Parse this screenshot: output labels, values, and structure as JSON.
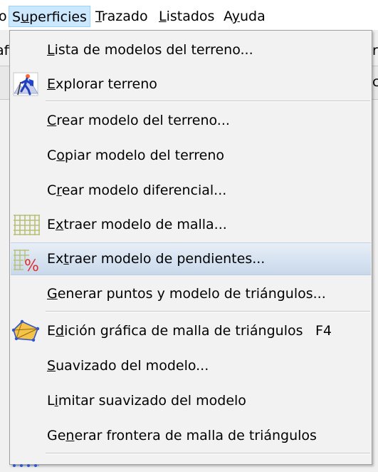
{
  "menubar": {
    "items": [
      {
        "label": "o",
        "mnemonic_pre": "o",
        "mnemonic": "",
        "mnemonic_post": ""
      },
      {
        "label": "Superficies",
        "pre": "S",
        "mn": "u",
        "post": "perficies"
      },
      {
        "label": "Trazado",
        "pre": "",
        "mn": "T",
        "post": "razado"
      },
      {
        "label": "Listados",
        "pre": "",
        "mn": "L",
        "post": "istados"
      },
      {
        "label": "Ayuda",
        "pre": "A",
        "mn": "y",
        "post": "uda"
      }
    ]
  },
  "behind": {
    "left_fragment": "afi",
    "right_fragment_top": "r",
    "right_fragment_bottom": "c"
  },
  "menu": {
    "items": [
      {
        "pre": "",
        "mn": "L",
        "post": "ista de modelos del terreno...",
        "icon": "none"
      },
      {
        "pre": "",
        "mn": "E",
        "post": "xplorar terreno",
        "icon": "hiker-icon"
      },
      {
        "pre": "",
        "mn": "C",
        "post": "rear modelo del terreno...",
        "icon": "none"
      },
      {
        "pre": "C",
        "mn": "o",
        "post": "piar modelo del terreno",
        "icon": "none"
      },
      {
        "pre": "C",
        "mn": "r",
        "post": "ear modelo diferencial...",
        "icon": "none"
      },
      {
        "pre": "E",
        "mn": "x",
        "post": "traer modelo de malla...",
        "icon": "grid-icon"
      },
      {
        "pre": "Ex",
        "mn": "t",
        "post": "raer modelo de pendientes...",
        "icon": "grid-percent-icon"
      },
      {
        "pre": "",
        "mn": "G",
        "post": "enerar puntos y modelo de triángulos...",
        "icon": "none"
      },
      {
        "pre": "E",
        "mn": "d",
        "post": "ición gráfica de malla de triángulos",
        "icon": "triangle-mesh-icon",
        "shortcut": "F4"
      },
      {
        "pre": "",
        "mn": "S",
        "post": "uavizado del modelo...",
        "icon": "none"
      },
      {
        "pre": "L",
        "mn": "i",
        "post": "mitar suavizado del modelo",
        "icon": "none"
      },
      {
        "pre": "Ge",
        "mn": "n",
        "post": "erar frontera de malla de triángulos",
        "icon": "none"
      }
    ]
  },
  "colors": {
    "menubar_active_bg": "#cce8ff",
    "menu_bg": "#f2f2f2",
    "hover_bg": "#d4e1f0"
  }
}
